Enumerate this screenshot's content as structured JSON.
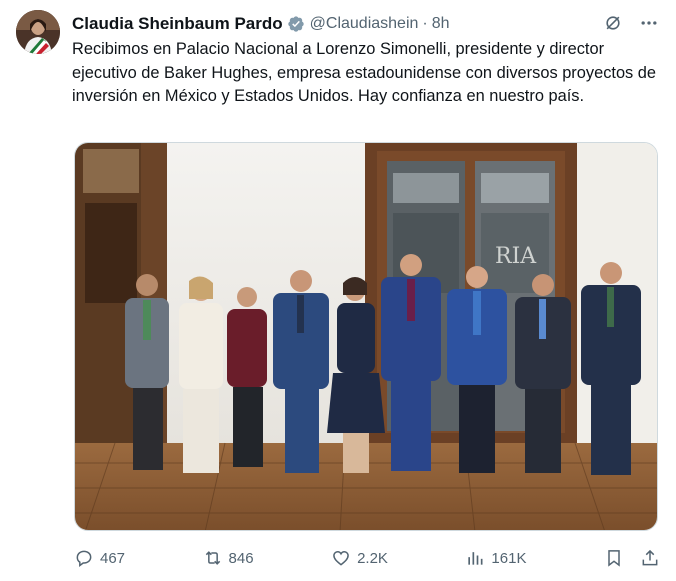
{
  "tweet": {
    "author_name": "Claudia Sheinbaum Pardo",
    "handle": "@Claudiashein",
    "separator": "·",
    "time": "8h",
    "text": "Recibimos en Palacio Nacional a Lorenzo Simonelli, presidente y director ejecutivo de Baker Hughes, empresa estadounidense con diversos proyectos de inversión en México y Estados Unidos. Hay confianza en nuestro país.",
    "photo_sign_text": "RIA"
  },
  "metrics": {
    "replies": "467",
    "reposts": "846",
    "likes": "2.2K",
    "views": "161K"
  },
  "icons": {
    "verified": "verified-badge-icon",
    "grok": "grok-icon",
    "more": "more-icon",
    "reply": "reply-icon",
    "repost": "repost-icon",
    "like": "like-icon",
    "views": "views-icon",
    "bookmark": "bookmark-icon",
    "share": "share-icon"
  },
  "colors": {
    "text": "#0f1419",
    "secondary": "#536471",
    "verified": "#829aab"
  }
}
